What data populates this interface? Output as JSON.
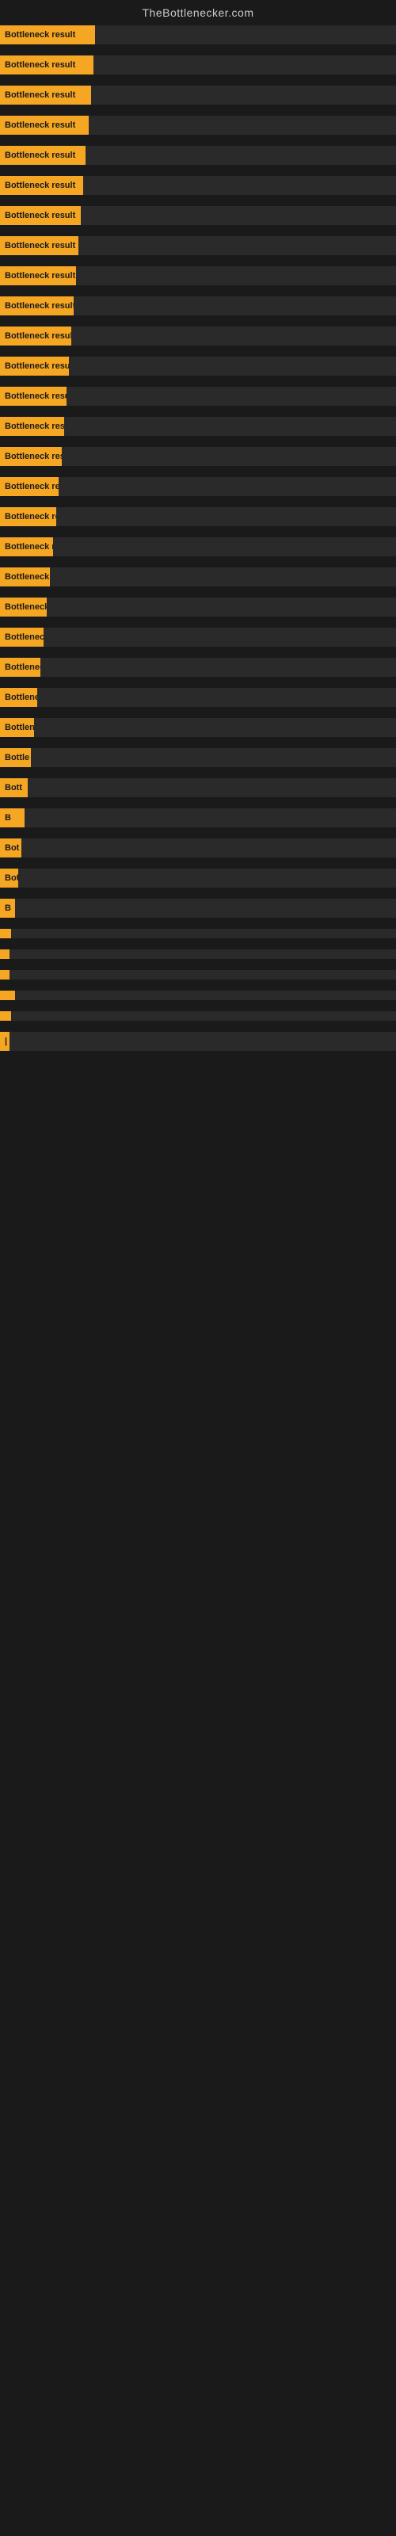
{
  "site": {
    "title": "TheBottlenecker.com"
  },
  "bars": [
    {
      "label": "Bottleneck result",
      "widthClass": "bar-w-full"
    },
    {
      "label": "Bottleneck result",
      "widthClass": "bar-w-1"
    },
    {
      "label": "Bottleneck result",
      "widthClass": "bar-w-2"
    },
    {
      "label": "Bottleneck result",
      "widthClass": "bar-w-3"
    },
    {
      "label": "Bottleneck result",
      "widthClass": "bar-w-4"
    },
    {
      "label": "Bottleneck result",
      "widthClass": "bar-w-5"
    },
    {
      "label": "Bottleneck result",
      "widthClass": "bar-w-6"
    },
    {
      "label": "Bottleneck result",
      "widthClass": "bar-w-7"
    },
    {
      "label": "Bottleneck result",
      "widthClass": "bar-w-8"
    },
    {
      "label": "Bottleneck result",
      "widthClass": "bar-w-9"
    },
    {
      "label": "Bottleneck result",
      "widthClass": "bar-w-10"
    },
    {
      "label": "Bottleneck result",
      "widthClass": "bar-w-11"
    },
    {
      "label": "Bottleneck result",
      "widthClass": "bar-w-12"
    },
    {
      "label": "Bottleneck result",
      "widthClass": "bar-w-13"
    },
    {
      "label": "Bottleneck result",
      "widthClass": "bar-w-14"
    },
    {
      "label": "Bottleneck resu",
      "widthClass": "bar-w-15"
    },
    {
      "label": "Bottleneck result",
      "widthClass": "bar-w-16"
    },
    {
      "label": "Bottleneck re",
      "widthClass": "bar-w-17"
    },
    {
      "label": "Bottleneck",
      "widthClass": "bar-w-18"
    },
    {
      "label": "Bottleneck re",
      "widthClass": "bar-w-19"
    },
    {
      "label": "Bottleneck r",
      "widthClass": "bar-w-20"
    },
    {
      "label": "Bottleneck resu",
      "widthClass": "bar-w-21"
    },
    {
      "label": "Bottlenec",
      "widthClass": "bar-w-22"
    },
    {
      "label": "Bottleneck re",
      "widthClass": "bar-w-23"
    },
    {
      "label": "Bottle",
      "widthClass": "bar-w-24"
    },
    {
      "label": "Bott",
      "widthClass": "bar-w-25"
    },
    {
      "label": "B",
      "widthClass": "bar-w-26"
    },
    {
      "label": "Bot",
      "widthClass": "bar-w-27"
    },
    {
      "label": "Bottlen",
      "widthClass": "bar-w-28"
    },
    {
      "label": "B",
      "widthClass": "bar-w-29"
    },
    {
      "label": "",
      "widthClass": "bar-w-30"
    },
    {
      "label": "",
      "widthClass": "bar-w-31"
    },
    {
      "label": "",
      "widthClass": "bar-w-32"
    },
    {
      "label": "",
      "widthClass": "bar-w-29"
    },
    {
      "label": "",
      "widthClass": "bar-w-30"
    },
    {
      "label": "|",
      "widthClass": "bar-w-32"
    }
  ]
}
